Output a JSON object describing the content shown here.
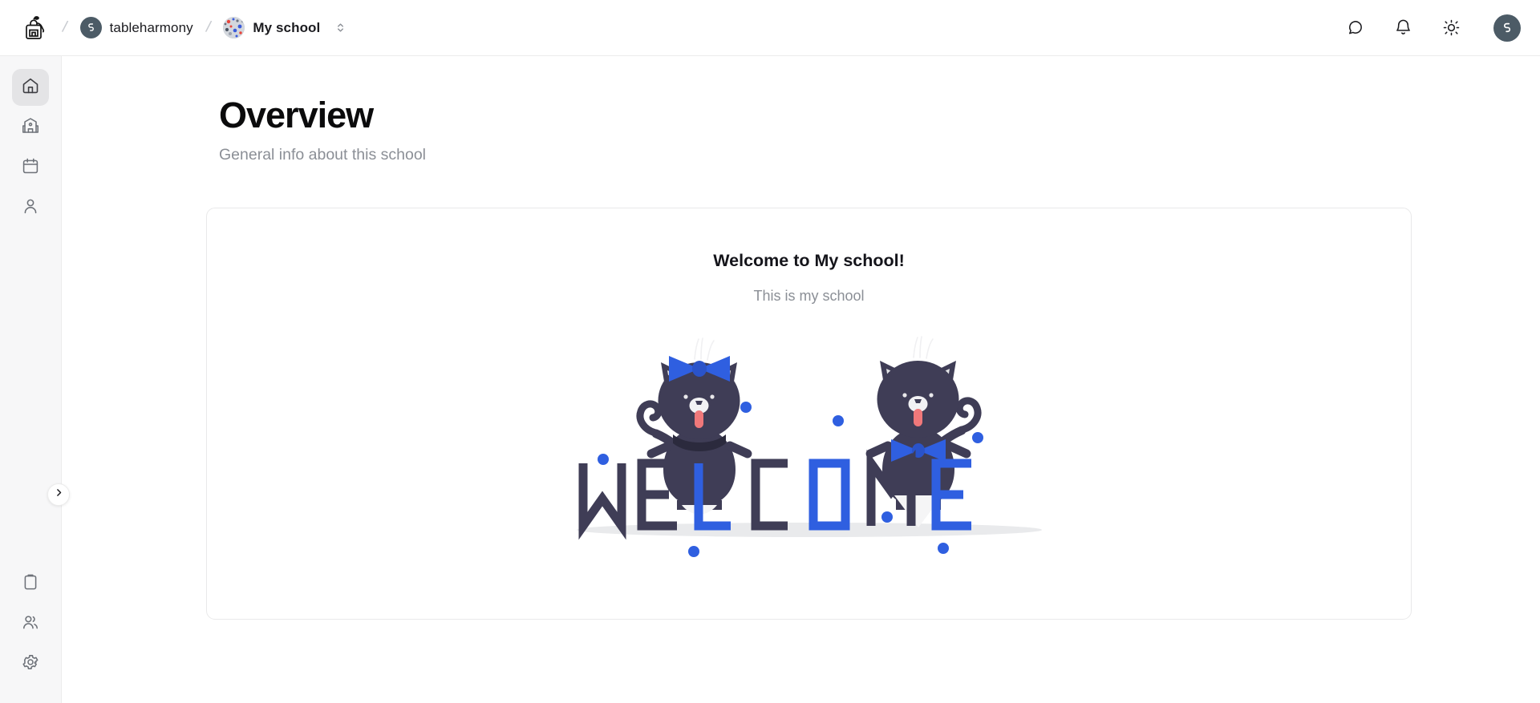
{
  "colors": {
    "accent_blue": "#2f5fe0",
    "dark_navy": "#3f3d56",
    "avatar_slate": "#4c5b66",
    "sidebar_bg": "#f7f7f8",
    "active_bg": "#e4e4e6",
    "border": "#e9e9ea",
    "muted_text": "#8b8f96",
    "tongue_pink": "#f0787a"
  },
  "header": {
    "logo_icon": "backpack-logo-icon",
    "separator": "/",
    "breadcrumbs": [
      {
        "label": "tableharmony",
        "avatar_icon": "tableharmony-avatar-icon"
      },
      {
        "label": "My school",
        "avatar_icon": "school-avatar-icon"
      }
    ],
    "switcher_icon": "chevron-up-down-icon",
    "actions": [
      {
        "name": "feedback-icon",
        "icon": "chat-bubble-icon"
      },
      {
        "name": "notifications-icon",
        "icon": "bell-icon"
      },
      {
        "name": "theme-toggle-icon",
        "icon": "sun-icon"
      }
    ],
    "user_avatar_icon": "user-avatar-icon"
  },
  "sidebar": {
    "top_items": [
      {
        "name": "sidebar-item-home",
        "icon": "home-icon",
        "active": true
      },
      {
        "name": "sidebar-item-school",
        "icon": "school-building-icon",
        "active": false
      },
      {
        "name": "sidebar-item-calendar",
        "icon": "calendar-icon",
        "active": false
      },
      {
        "name": "sidebar-item-profile",
        "icon": "user-icon",
        "active": false
      }
    ],
    "bottom_items": [
      {
        "name": "sidebar-item-assignments",
        "icon": "clipboard-icon",
        "active": false
      },
      {
        "name": "sidebar-item-members",
        "icon": "users-icon",
        "active": false
      },
      {
        "name": "sidebar-item-settings",
        "icon": "gear-icon",
        "active": false
      }
    ],
    "expand_icon": "chevron-right-icon"
  },
  "main": {
    "title": "Overview",
    "subtitle": "General info about this school",
    "card": {
      "heading": "Welcome to My school!",
      "description": "This is my school",
      "illustration": {
        "name": "welcome-cats-illustration",
        "word": "WELCOME",
        "letter_colors": [
          "dark",
          "dark",
          "blue",
          "dark",
          "blue",
          "dark",
          "blue"
        ],
        "cats": [
          {
            "name": "cat-left",
            "accessory": "hair-bow"
          },
          {
            "name": "cat-right",
            "accessory": "bow-tie"
          }
        ],
        "dot_count": 7
      }
    }
  }
}
